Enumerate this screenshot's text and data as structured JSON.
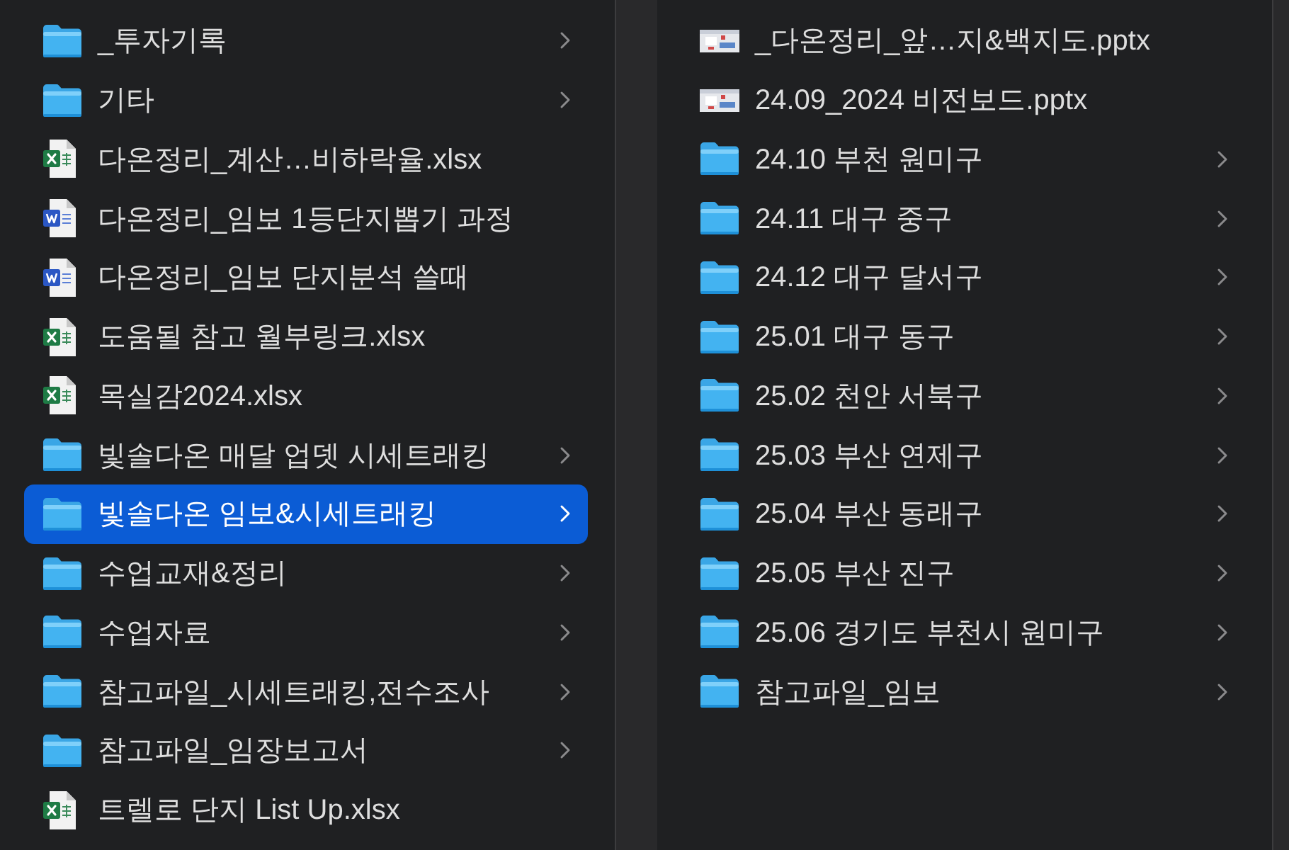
{
  "columns": [
    {
      "items": [
        {
          "name": "_투자기록",
          "kind": "folder",
          "selected": false
        },
        {
          "name": "기타",
          "kind": "folder",
          "selected": false
        },
        {
          "name": "다온정리_계산…비하락율.xlsx",
          "kind": "spreadsheet",
          "selected": false
        },
        {
          "name": "다온정리_임보 1등단지뽑기 과정",
          "kind": "document",
          "selected": false
        },
        {
          "name": "다온정리_임보 단지분석 쓸때",
          "kind": "document",
          "selected": false
        },
        {
          "name": "도움될 참고 월부링크.xlsx",
          "kind": "spreadsheet",
          "selected": false
        },
        {
          "name": "목실감2024.xlsx",
          "kind": "spreadsheet",
          "selected": false
        },
        {
          "name": "빛솔다온 매달 업뎃 시세트래킹",
          "kind": "folder",
          "selected": false
        },
        {
          "name": "빛솔다온 임보&시세트래킹",
          "kind": "folder",
          "selected": true
        },
        {
          "name": "수업교재&정리",
          "kind": "folder",
          "selected": false
        },
        {
          "name": "수업자료",
          "kind": "folder",
          "selected": false
        },
        {
          "name": "참고파일_시세트래킹,전수조사",
          "kind": "folder",
          "selected": false
        },
        {
          "name": "참고파일_임장보고서",
          "kind": "folder",
          "selected": false
        },
        {
          "name": "트렐로 단지 List Up.xlsx",
          "kind": "spreadsheet",
          "selected": false
        }
      ]
    },
    {
      "items": [
        {
          "name": "_다온정리_앞…지&백지도.pptx",
          "kind": "presentation",
          "selected": false
        },
        {
          "name": "24.09_2024 비전보드.pptx",
          "kind": "presentation",
          "selected": false
        },
        {
          "name": "24.10 부천 원미구",
          "kind": "folder",
          "selected": false
        },
        {
          "name": "24.11 대구 중구",
          "kind": "folder",
          "selected": false
        },
        {
          "name": "24.12 대구 달서구",
          "kind": "folder",
          "selected": false
        },
        {
          "name": "25.01 대구 동구",
          "kind": "folder",
          "selected": false
        },
        {
          "name": "25.02 천안 서북구",
          "kind": "folder",
          "selected": false
        },
        {
          "name": "25.03 부산 연제구",
          "kind": "folder",
          "selected": false
        },
        {
          "name": "25.04 부산 동래구",
          "kind": "folder",
          "selected": false
        },
        {
          "name": "25.05 부산 진구",
          "kind": "folder",
          "selected": false
        },
        {
          "name": "25.06 경기도 부천시 원미구",
          "kind": "folder",
          "selected": false
        },
        {
          "name": "참고파일_임보",
          "kind": "folder",
          "selected": false
        }
      ]
    }
  ]
}
